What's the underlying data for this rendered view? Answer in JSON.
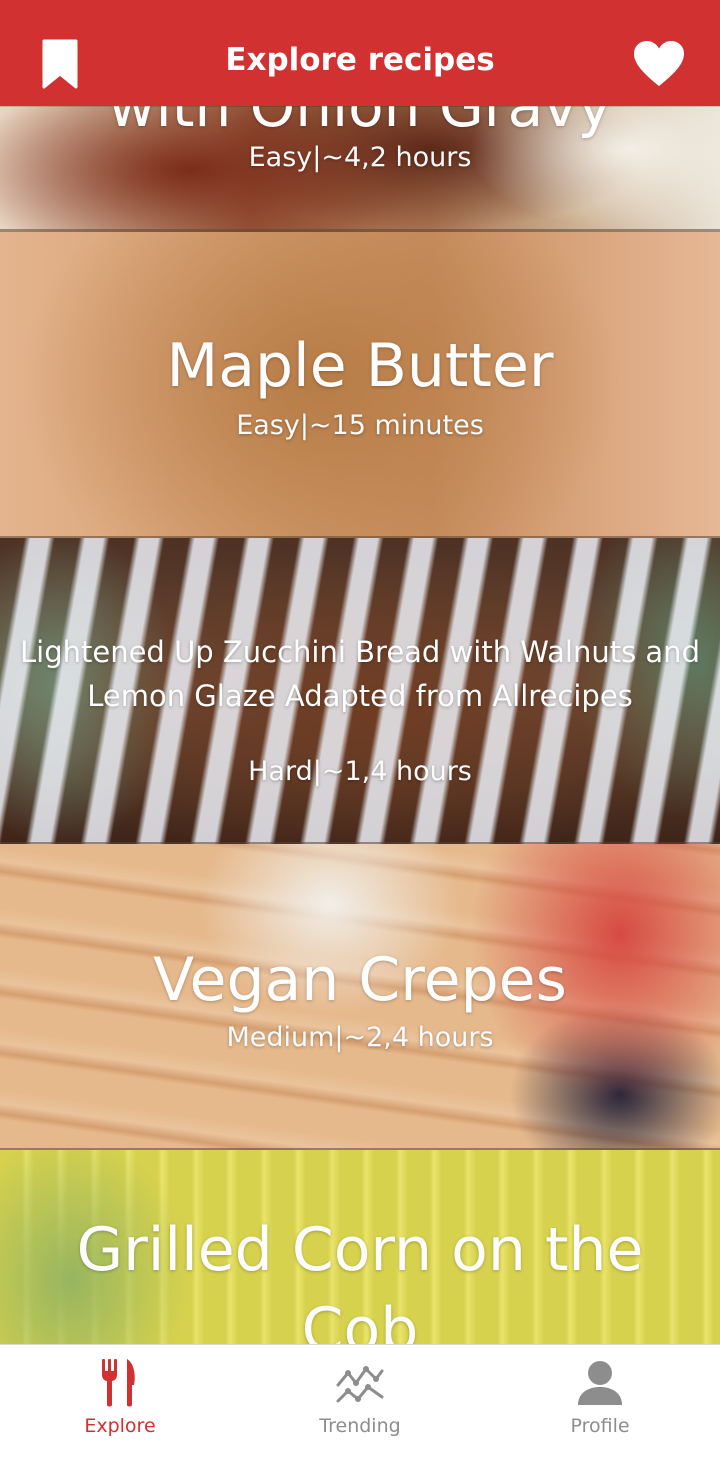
{
  "header": {
    "title": "Explore recipes",
    "left_icon": "bookmark-icon",
    "right_icon": "heart-icon",
    "color": "#d13131"
  },
  "recipes": [
    {
      "title": "with Onion Gravy",
      "meta": "Easy|~4,2 hours"
    },
    {
      "title": "Maple Butter",
      "meta": "Easy|~15 minutes"
    },
    {
      "title": "Lightened Up Zucchini Bread with Walnuts and Lemon Glaze Adapted from Allrecipes",
      "meta": "Hard|~1,4 hours"
    },
    {
      "title": "Vegan Crepes",
      "meta": "Medium|~2,4 hours"
    },
    {
      "title": "Grilled Corn on the Cob",
      "meta": ""
    }
  ],
  "tabbar": {
    "active_color": "#d13131",
    "inactive_color": "#8d8d8d",
    "tabs": [
      {
        "label": "Explore",
        "icon": "fork-knife-icon",
        "active": true
      },
      {
        "label": "Trending",
        "icon": "trending-chart-icon",
        "active": false
      },
      {
        "label": "Profile",
        "icon": "person-icon",
        "active": false
      }
    ]
  }
}
